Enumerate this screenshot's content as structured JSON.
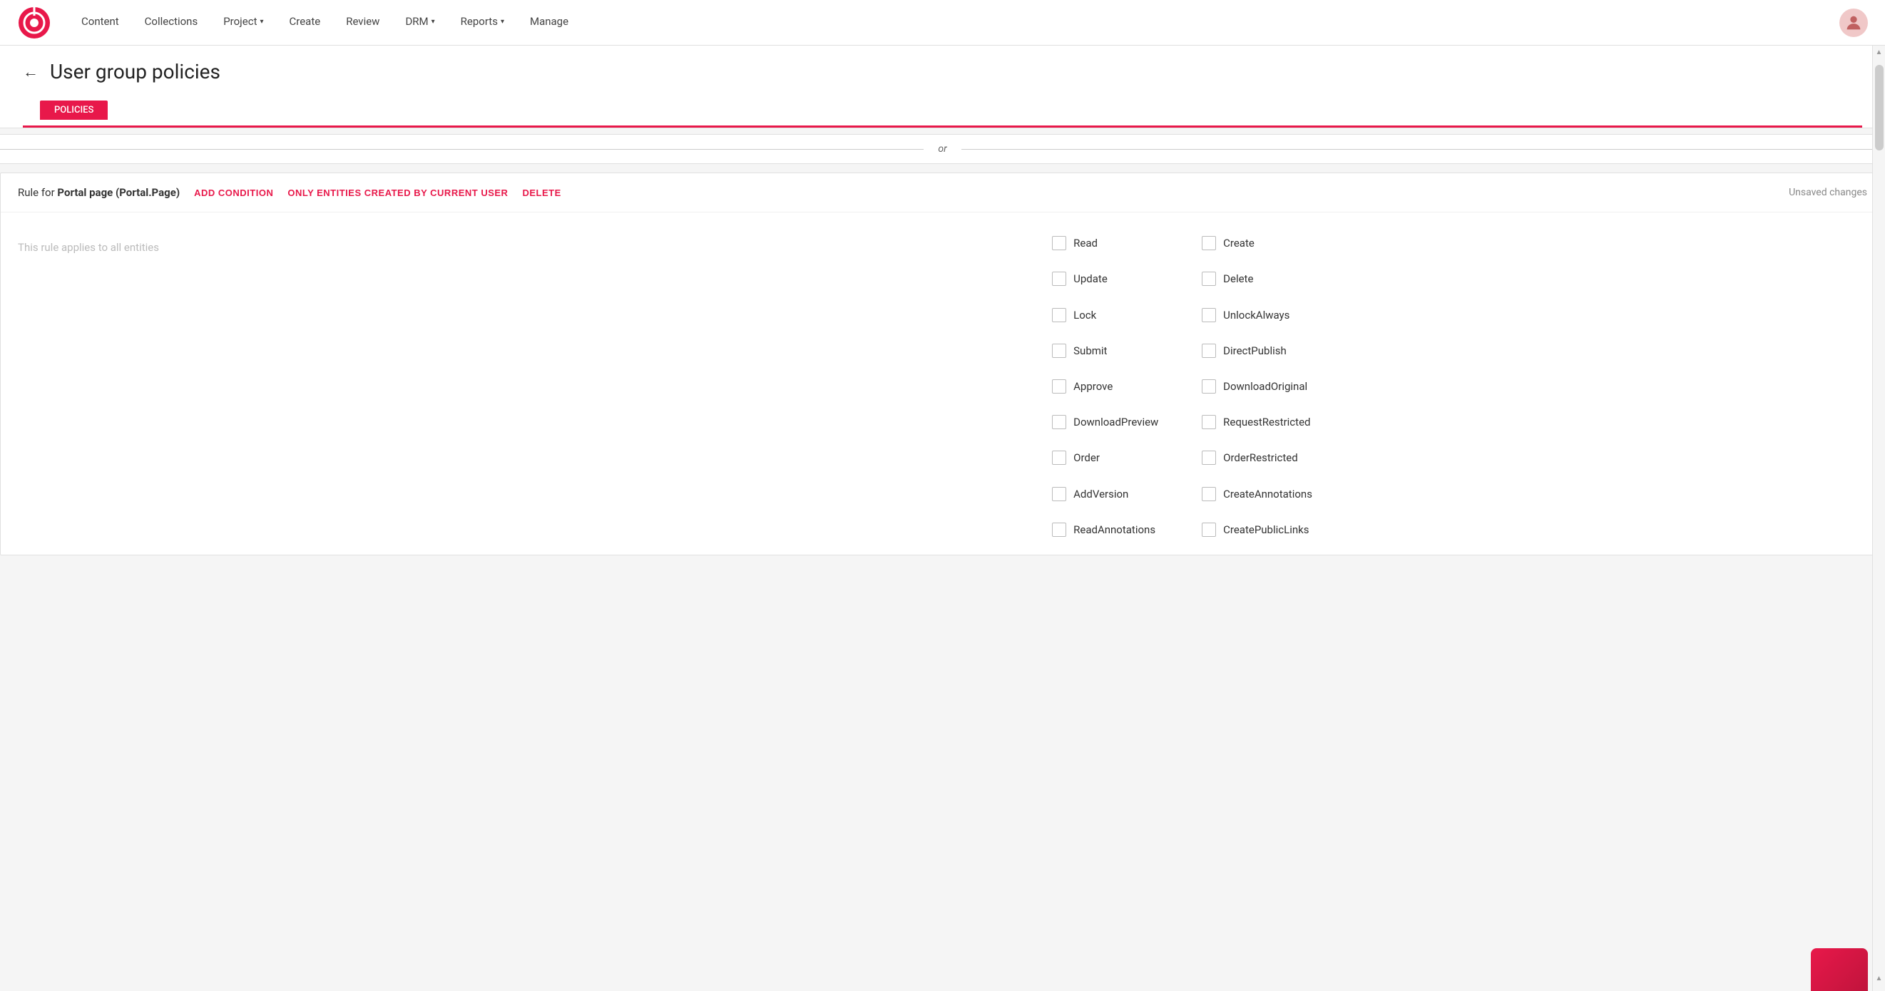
{
  "app": {
    "logo_alt": "Brand Logo"
  },
  "navbar": {
    "items": [
      {
        "label": "Content",
        "has_dropdown": false
      },
      {
        "label": "Collections",
        "has_dropdown": false
      },
      {
        "label": "Project",
        "has_dropdown": true
      },
      {
        "label": "Create",
        "has_dropdown": false
      },
      {
        "label": "Review",
        "has_dropdown": false
      },
      {
        "label": "DRM",
        "has_dropdown": true
      },
      {
        "label": "Reports",
        "has_dropdown": true
      },
      {
        "label": "Manage",
        "has_dropdown": false
      }
    ]
  },
  "page": {
    "title": "User group policies",
    "back_label": "←"
  },
  "tabs": [
    {
      "label": "POLICIES",
      "active": true
    }
  ],
  "divider": {
    "text": "or"
  },
  "rule": {
    "rule_for_prefix": "Rule for ",
    "rule_for_entity": "Portal page (Portal.Page)",
    "add_condition_label": "ADD CONDITION",
    "only_entities_label": "ONLY ENTITIES CREATED BY CURRENT USER",
    "delete_label": "DELETE",
    "unsaved_label": "Unsaved changes",
    "placeholder": "This rule applies to all entities",
    "permissions": [
      {
        "id": "read",
        "label": "Read",
        "checked": false
      },
      {
        "id": "create",
        "label": "Create",
        "checked": false
      },
      {
        "id": "update",
        "label": "Update",
        "checked": false
      },
      {
        "id": "delete",
        "label": "Delete",
        "checked": false
      },
      {
        "id": "lock",
        "label": "Lock",
        "checked": false
      },
      {
        "id": "unlock_always",
        "label": "UnlockAlways",
        "checked": false
      },
      {
        "id": "submit",
        "label": "Submit",
        "checked": false
      },
      {
        "id": "direct_publish",
        "label": "DirectPublish",
        "checked": false
      },
      {
        "id": "approve",
        "label": "Approve",
        "checked": false
      },
      {
        "id": "download_original",
        "label": "DownloadOriginal",
        "checked": false
      },
      {
        "id": "download_preview",
        "label": "DownloadPreview",
        "checked": false
      },
      {
        "id": "request_restricted",
        "label": "RequestRestricted",
        "checked": false
      },
      {
        "id": "order",
        "label": "Order",
        "checked": false
      },
      {
        "id": "order_restricted",
        "label": "OrderRestricted",
        "checked": false
      },
      {
        "id": "add_version",
        "label": "AddVersion",
        "checked": false
      },
      {
        "id": "create_annotations",
        "label": "CreateAnnotations",
        "checked": false
      },
      {
        "id": "read_annotations",
        "label": "ReadAnnotations",
        "checked": false
      },
      {
        "id": "create_public_links",
        "label": "CreatePublicLinks",
        "checked": false
      }
    ]
  },
  "colors": {
    "accent": "#e8184a",
    "accent_dark": "#c0143c"
  }
}
